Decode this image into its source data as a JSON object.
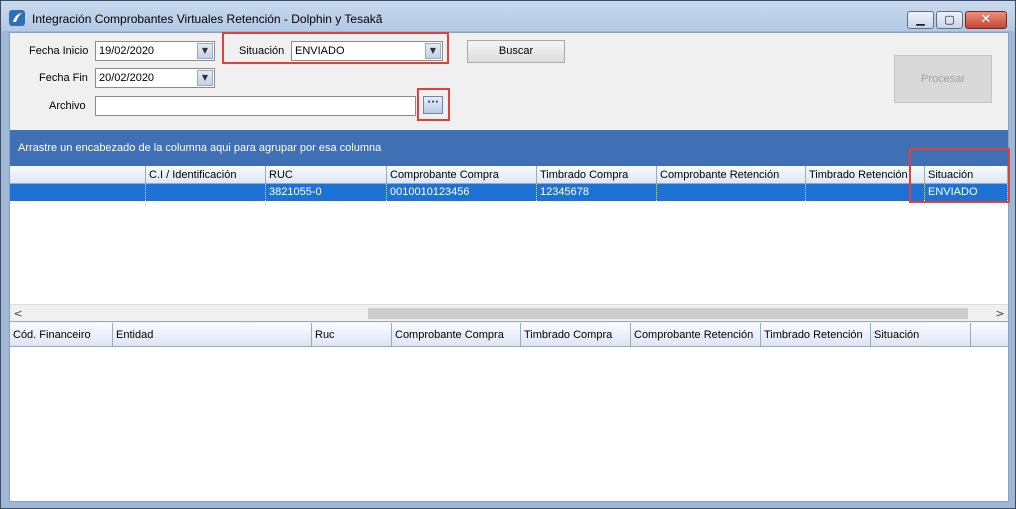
{
  "window": {
    "title": "Integración Comprobantes Virtuales Retención - Dolphin y Tesakã",
    "controls": {
      "minimize": "▁",
      "maximize": "▢",
      "close": "✕"
    }
  },
  "filters": {
    "fecha_inicio_label": "Fecha Inicio",
    "fecha_inicio_value": "19/02/2020",
    "fecha_fin_label": "Fecha Fin",
    "fecha_fin_value": "20/02/2020",
    "situacion_label": "Situación",
    "situacion_value": "ENVIADO",
    "archivo_label": "Archivo",
    "archivo_value": "",
    "browse_label": "···",
    "buscar_label": "Buscar",
    "procesar_label": "Procesar"
  },
  "group_panel_text": "Arrastre un encabezado de la columna aqui para agrupar por esa columna",
  "grid_top": {
    "columns": [
      "",
      "C.I / Identificación",
      "RUC",
      "Comprobante Compra",
      "Timbrado Compra",
      "Comprobante Retención",
      "Timbrado Retención",
      "Situación"
    ],
    "rows": [
      [
        "",
        "",
        "3821055-0",
        "0010010123456",
        "12345678",
        "",
        "",
        "ENVIADO"
      ]
    ],
    "scroll_left": "<",
    "scroll_right": ">"
  },
  "grid_bottom": {
    "columns": [
      "Cód. Financeiro",
      "Entidad",
      "Ruc",
      "Comprobante Compra",
      "Timbrado Compra",
      "Comprobante Retención",
      "Timbrado Retención",
      "Situación"
    ]
  },
  "colors": {
    "group_panel": "#3f6fb4",
    "selected_row": "#1e72d6",
    "highlight": "#e0413a"
  }
}
